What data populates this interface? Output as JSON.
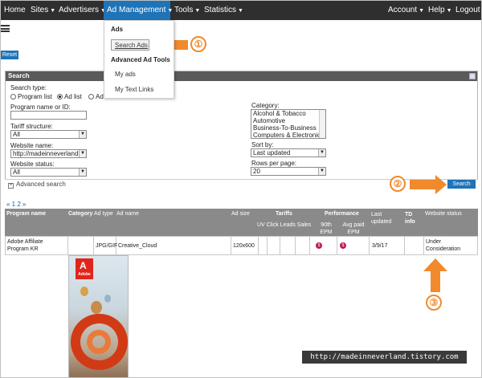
{
  "nav": {
    "left": [
      {
        "label": "Home",
        "caret": false
      },
      {
        "label": "Sites",
        "caret": true
      },
      {
        "label": "Advertisers",
        "caret": true
      },
      {
        "label": "Ad Management",
        "caret": true,
        "active": true
      },
      {
        "label": "Tools",
        "caret": true
      },
      {
        "label": "Statistics",
        "caret": true
      }
    ],
    "right": [
      {
        "label": "Account",
        "caret": true
      },
      {
        "label": "Help",
        "caret": true
      },
      {
        "label": "Logout",
        "caret": false
      }
    ],
    "caret_glyph": "▼"
  },
  "dropdown": {
    "heading1": "Ads",
    "search_ads": "Search Ads",
    "heading2": "Advanced Ad Tools",
    "my_ads": "My ads",
    "my_text_links": "My Text Links"
  },
  "toolbar": {
    "reset": "Reset"
  },
  "search": {
    "title": "Search",
    "search_type_label": "Search type:",
    "radio_program_list": "Program list",
    "radio_ad_list": "Ad list",
    "radio_ad_truncated": "Ad",
    "program_label": "Program name or ID:",
    "program_value": "",
    "tariff_label": "Tariff structure:",
    "tariff_value": "All",
    "website_name_label": "Website name:",
    "website_name_value": "http://madeinneverland.",
    "website_status_label": "Website status:",
    "website_status_value": "All",
    "category_label": "Category:",
    "category_options": [
      "Alcohol & Tobacco",
      "Automotive",
      "Business-To-Business",
      "Computers & Electronics"
    ],
    "sort_label": "Sort by:",
    "sort_value": "Last updated",
    "rows_label": "Rows per page:",
    "rows_value": "20",
    "advanced": "Advanced search",
    "button": "Search"
  },
  "pager": {
    "text": "« 1 2 »"
  },
  "table": {
    "headers": {
      "program_name": "Program name",
      "category": "Category",
      "ad_type": "Ad type",
      "ad_name": "Ad name",
      "ad_size": "Ad size",
      "tariffs": "Tariffs",
      "performance": "Performance",
      "last_updated": "Last updated",
      "td_info": "TD info",
      "website_status": "Website status",
      "tariff_sub": "UV Click Leads Sales",
      "epm90": "90th EPM",
      "avg_paid": "Avg paid EPM"
    },
    "row": {
      "program_name": "Adobe Affiliate Program KR",
      "ad_type": "JPG/GIF",
      "ad_name": "Creative_Cloud",
      "ad_size": "120x600",
      "epm_icon": "$",
      "avg_icon": "$",
      "last_updated": "3/9/17",
      "website_status": "Under Consideration"
    }
  },
  "banner": {
    "brand": "Adobe"
  },
  "annotations": {
    "n1": "①",
    "n2": "②",
    "n3": "③",
    "color": "#f08a2c"
  },
  "watermark": "http://madeinneverland.tistory.com"
}
